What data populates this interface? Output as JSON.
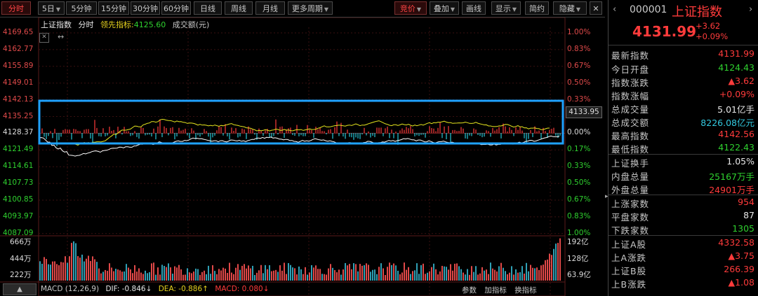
{
  "toolbar": {
    "tabs": [
      "分时",
      "5日",
      "5分钟",
      "15分钟",
      "30分钟",
      "60分钟",
      "日线",
      "周线",
      "月线",
      "更多周期"
    ],
    "right_buttons": [
      "竞价",
      "叠加",
      "画线",
      "显示",
      "简约",
      "隐藏"
    ],
    "close": "✕"
  },
  "chart": {
    "title": "上证指数",
    "mode": "分时",
    "lead_label": "领先指标:",
    "lead_value": "4125.60",
    "turnover_label": "成交额(元)",
    "price_ticks": [
      "4169.65",
      "4162.77",
      "4155.89",
      "4149.01",
      "4142.13",
      "4135.25",
      "4128.37",
      "4121.49",
      "4114.61",
      "4107.73",
      "4100.85",
      "4093.97",
      "4087.09"
    ],
    "pct_ticks": [
      "1.00%",
      "0.83%",
      "0.67%",
      "0.50%",
      "0.33%",
      "0.17%",
      "0.00%",
      "0.17%",
      "0.33%",
      "0.50%",
      "0.67%",
      "0.83%",
      "1.00%"
    ],
    "current_tag": "4133.95",
    "vol_ticks_left": [
      "666万",
      "444万",
      "222万"
    ],
    "vol_ticks_right": [
      "192亿",
      "128亿",
      "63.9亿"
    ],
    "macd_label": "MACD (12,26,9)",
    "dif_label": "DIF: -0.846↓",
    "dea_label": "DEA: -0.886↑",
    "macd_value": "MACD: 0.080↓",
    "bottom_buttons": [
      "参数",
      "加指标",
      "换指标"
    ],
    "colors": {
      "price_line": "#ffffff",
      "lead_line": "#e6e61e",
      "up": "#ff3b3b",
      "down": "#25c9d9",
      "box": "#1fa2ff"
    }
  },
  "panel": {
    "code": "000001",
    "name": "上证指数",
    "price": "4131.99",
    "change": "+3.62",
    "change_pct": "+0.09%",
    "rows": [
      {
        "label": "最新指数",
        "value": "4131.99",
        "color": "red"
      },
      {
        "label": "今日开盘",
        "value": "4124.43",
        "color": "green"
      },
      {
        "label": "指数涨跌",
        "value": "▲3.62",
        "color": "red"
      },
      {
        "label": "指数涨幅",
        "value": "+0.09%",
        "color": "red"
      },
      {
        "label": "总成交量",
        "value": "5.01亿手",
        "color": "white"
      },
      {
        "label": "总成交额",
        "value": "8226.08亿元",
        "color": "cyan"
      },
      {
        "label": "最高指数",
        "value": "4142.56",
        "color": "red"
      },
      {
        "label": "最低指数",
        "value": "4122.43",
        "color": "green"
      },
      {
        "label": "上证换手",
        "value": "1.05%",
        "color": "white"
      },
      {
        "label": "内盘总量",
        "value": "25167万手",
        "color": "green"
      },
      {
        "label": "外盘总量",
        "value": "24901万手",
        "color": "red"
      },
      {
        "label": "上涨家数",
        "value": "954",
        "color": "red"
      },
      {
        "label": "平盘家数",
        "value": "87",
        "color": "white"
      },
      {
        "label": "下跌家数",
        "value": "1305",
        "color": "green"
      },
      {
        "label": "上证A股",
        "value": "4332.58",
        "color": "red"
      },
      {
        "label": "上A涨跌",
        "value": "▲3.75",
        "color": "red"
      },
      {
        "label": "上证B股",
        "value": "266.39",
        "color": "red"
      },
      {
        "label": "上B涨跌",
        "value": "▲1.08",
        "color": "red"
      }
    ]
  }
}
